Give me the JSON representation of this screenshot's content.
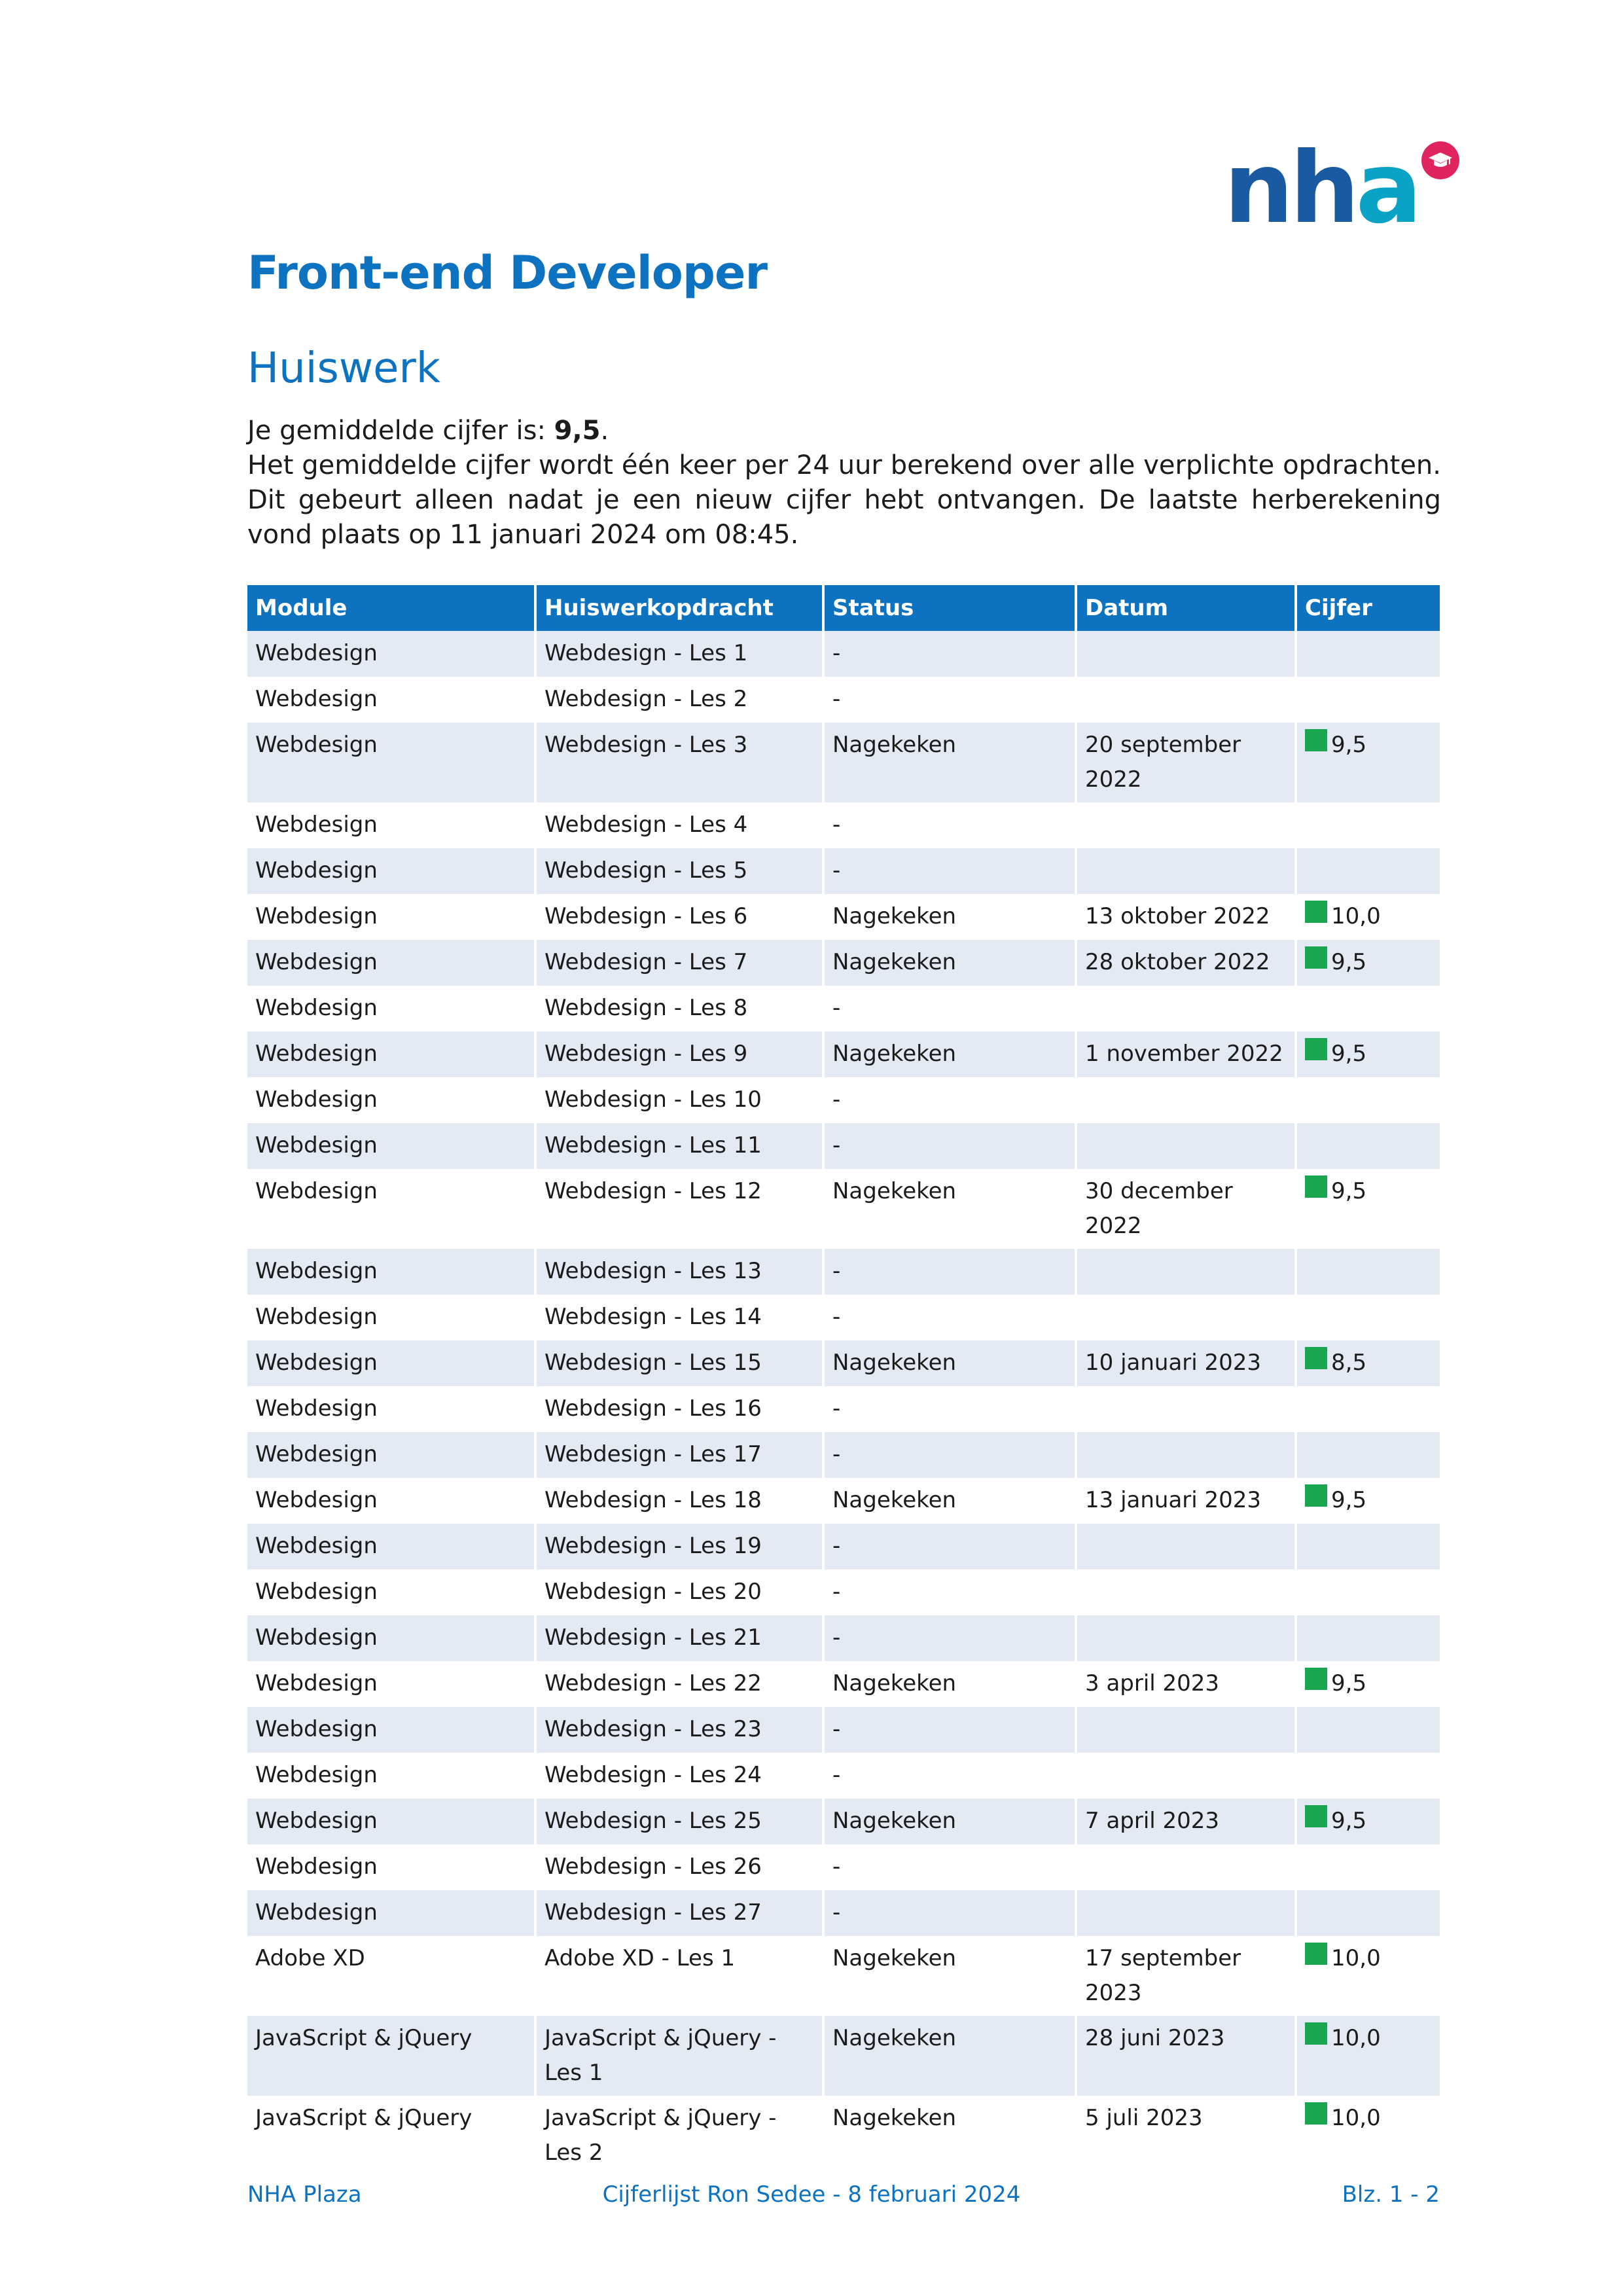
{
  "logo": {
    "text_n": "nh",
    "text_a": "a",
    "icon": "graduation-cap-icon",
    "color_primary": "#1a5aa0",
    "color_accent": "#0aa3c5",
    "color_dot": "#e0245e"
  },
  "title": "Front-end Developer",
  "section": "Huiswerk",
  "intro": {
    "avg_label": "Je gemiddelde cijfer is: ",
    "avg_value": "9,5",
    "avg_suffix": ".",
    "text": "Het gemiddelde cijfer wordt één keer per 24 uur berekend over alle verplichte opdrachten. Dit gebeurt alleen nadat je een nieuw cijfer hebt ontvangen. De laatste herberekening vond plaats op 11 januari 2024 om 08:45."
  },
  "table": {
    "headers": [
      "Module",
      "Huiswerkopdracht",
      "Status",
      "Datum",
      "Cijfer"
    ],
    "grade_marker_color": "#1aa550",
    "rows": [
      [
        "Webdesign",
        "Webdesign - Les 1",
        "-",
        "",
        ""
      ],
      [
        "Webdesign",
        "Webdesign - Les 2",
        "-",
        "",
        ""
      ],
      [
        "Webdesign",
        "Webdesign - Les 3",
        "Nagekeken",
        "20 september 2022",
        "9,5"
      ],
      [
        "Webdesign",
        "Webdesign - Les 4",
        "-",
        "",
        ""
      ],
      [
        "Webdesign",
        "Webdesign - Les 5",
        "-",
        "",
        ""
      ],
      [
        "Webdesign",
        "Webdesign - Les 6",
        "Nagekeken",
        "13 oktober 2022",
        "10,0"
      ],
      [
        "Webdesign",
        "Webdesign - Les 7",
        "Nagekeken",
        "28 oktober 2022",
        "9,5"
      ],
      [
        "Webdesign",
        "Webdesign - Les 8",
        "-",
        "",
        ""
      ],
      [
        "Webdesign",
        "Webdesign - Les 9",
        "Nagekeken",
        "1 november 2022",
        "9,5"
      ],
      [
        "Webdesign",
        "Webdesign - Les 10",
        "-",
        "",
        ""
      ],
      [
        "Webdesign",
        "Webdesign - Les 11",
        "-",
        "",
        ""
      ],
      [
        "Webdesign",
        "Webdesign - Les 12",
        "Nagekeken",
        "30 december 2022",
        "9,5"
      ],
      [
        "Webdesign",
        "Webdesign - Les 13",
        "-",
        "",
        ""
      ],
      [
        "Webdesign",
        "Webdesign - Les 14",
        "-",
        "",
        ""
      ],
      [
        "Webdesign",
        "Webdesign - Les 15",
        "Nagekeken",
        "10 januari 2023",
        "8,5"
      ],
      [
        "Webdesign",
        "Webdesign - Les 16",
        "-",
        "",
        ""
      ],
      [
        "Webdesign",
        "Webdesign - Les 17",
        "-",
        "",
        ""
      ],
      [
        "Webdesign",
        "Webdesign - Les 18",
        "Nagekeken",
        "13 januari 2023",
        "9,5"
      ],
      [
        "Webdesign",
        "Webdesign - Les 19",
        "-",
        "",
        ""
      ],
      [
        "Webdesign",
        "Webdesign - Les 20",
        "-",
        "",
        ""
      ],
      [
        "Webdesign",
        "Webdesign - Les 21",
        "-",
        "",
        ""
      ],
      [
        "Webdesign",
        "Webdesign - Les 22",
        "Nagekeken",
        "3 april 2023",
        "9,5"
      ],
      [
        "Webdesign",
        "Webdesign - Les 23",
        "-",
        "",
        ""
      ],
      [
        "Webdesign",
        "Webdesign - Les 24",
        "-",
        "",
        ""
      ],
      [
        "Webdesign",
        "Webdesign - Les 25",
        "Nagekeken",
        "7 april 2023",
        "9,5"
      ],
      [
        "Webdesign",
        "Webdesign - Les 26",
        "-",
        "",
        ""
      ],
      [
        "Webdesign",
        "Webdesign - Les 27",
        "-",
        "",
        ""
      ],
      [
        "Adobe XD",
        "Adobe XD - Les 1",
        "Nagekeken",
        "17 september 2023",
        "10,0"
      ],
      [
        "JavaScript & jQuery",
        "JavaScript & jQuery - Les 1",
        "Nagekeken",
        "28 juni 2023",
        "10,0"
      ],
      [
        "JavaScript & jQuery",
        "JavaScript & jQuery - Les 2",
        "Nagekeken",
        "5 juli 2023",
        "10,0"
      ]
    ]
  },
  "footer": {
    "left": "NHA Plaza",
    "center": "Cijferlijst Ron Sedee - 8 februari 2024",
    "right": "Blz. 1 - 2"
  }
}
